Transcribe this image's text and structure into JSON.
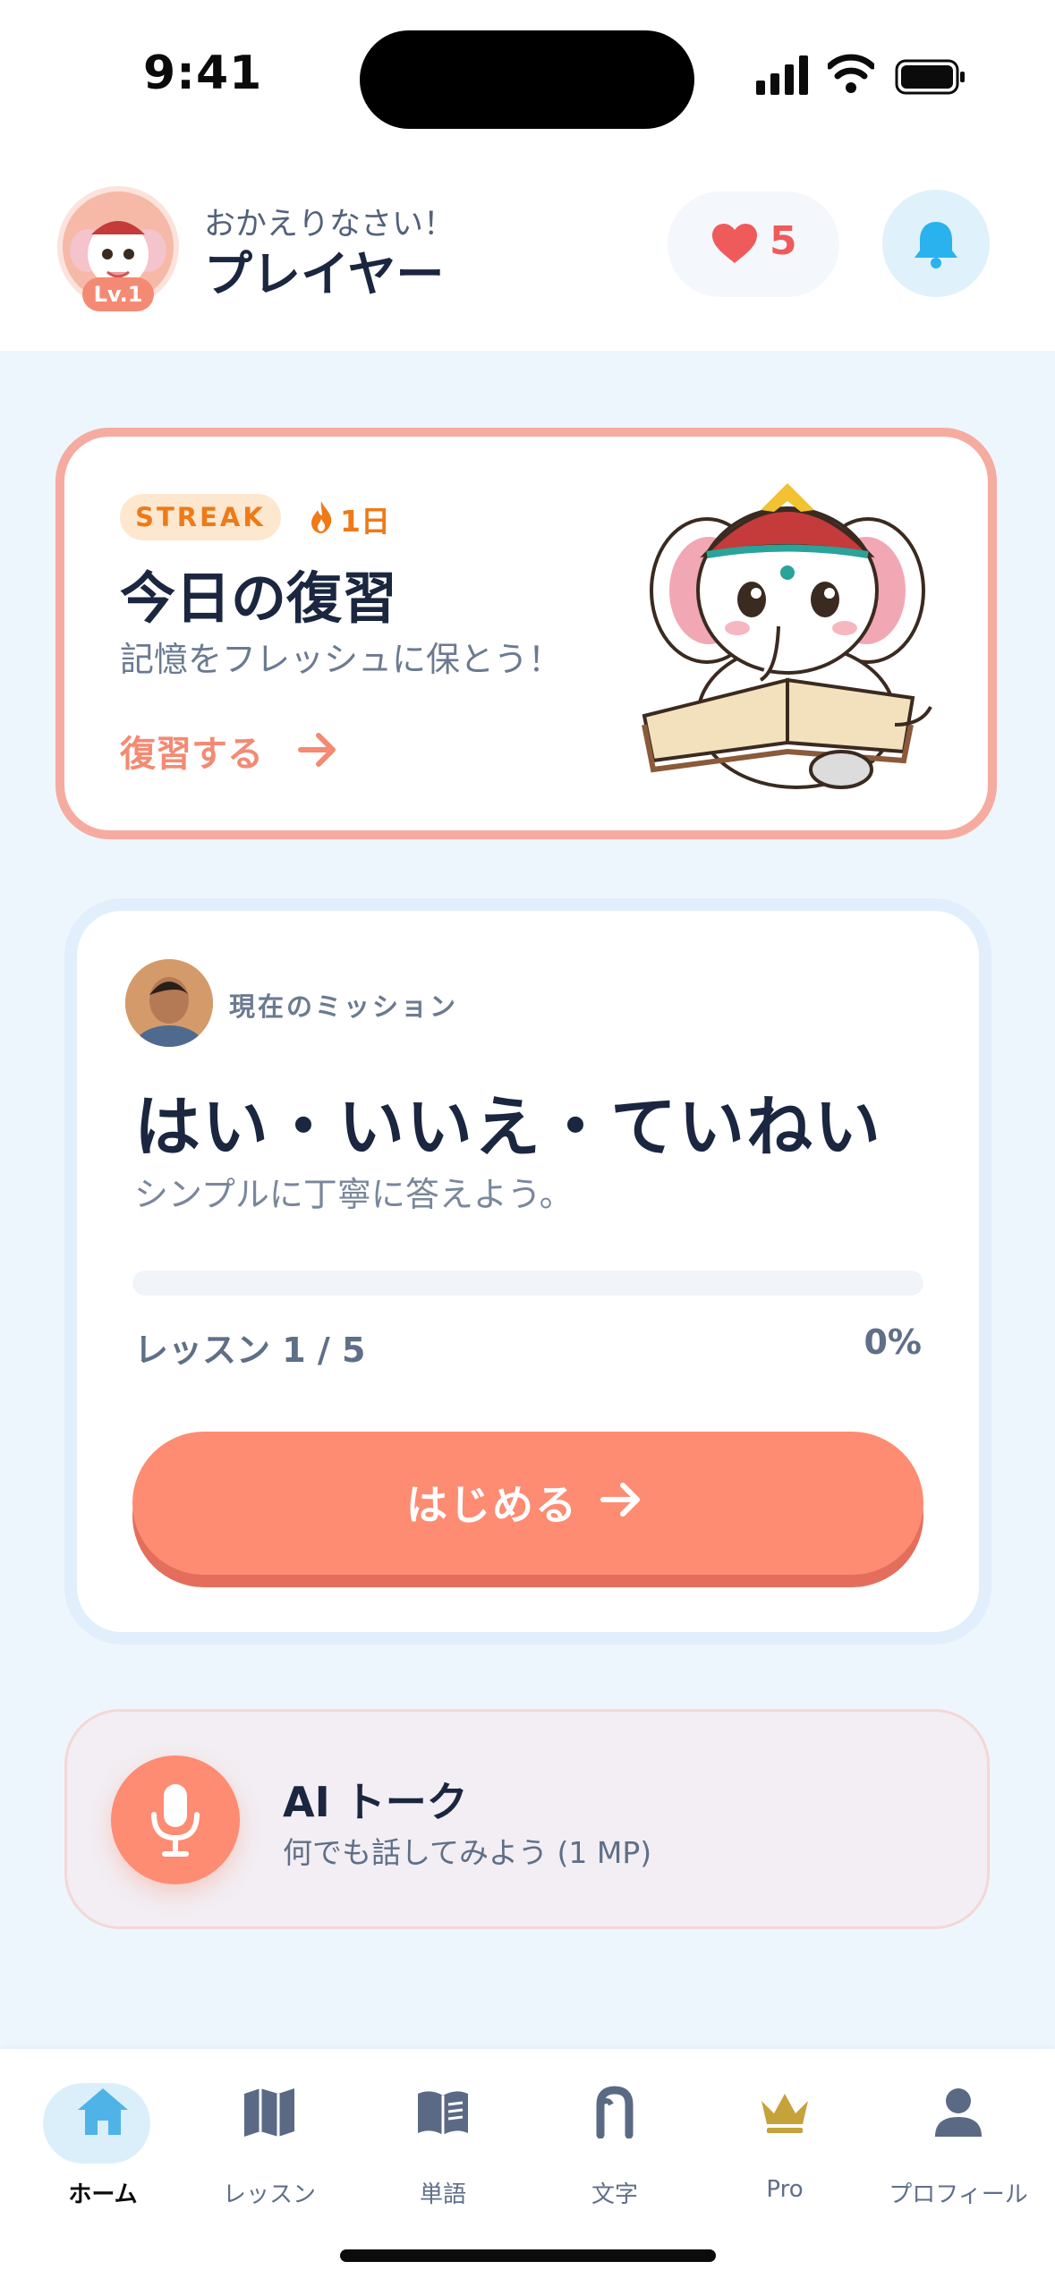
{
  "status_bar": {
    "time": "9:41"
  },
  "header": {
    "greeting": "おかえりなさい！",
    "username": "プレイヤー",
    "level": "Lv.1",
    "hearts": "5"
  },
  "review_card": {
    "badge": "STREAK",
    "streak_days": "1日",
    "title": "今日の復習",
    "subtitle": "記憶をフレッシュに保とう！",
    "link": "復習する"
  },
  "mission_card": {
    "label": "現在のミッション",
    "title": "はい・いいえ・ていねい",
    "subtitle": "シンプルに丁寧に答えよう。",
    "lesson_progress": "レッスン 1 / 5",
    "percent": "0%",
    "progress_fraction": 0,
    "start_label": "はじめる"
  },
  "ai_talk": {
    "title": "AI トーク",
    "subtitle": "何でも話してみよう (1 MP)"
  },
  "tabs": [
    {
      "label": "ホーム",
      "icon": "home-icon",
      "active": true
    },
    {
      "label": "レッスン",
      "icon": "map-icon",
      "active": false
    },
    {
      "label": "単語",
      "icon": "book-icon",
      "active": false
    },
    {
      "label": "文字",
      "icon": "thai-letter-icon",
      "active": false
    },
    {
      "label": "Pro",
      "icon": "crown-icon",
      "active": false
    },
    {
      "label": "プロフィール",
      "icon": "person-icon",
      "active": false
    }
  ],
  "colors": {
    "accent": "#fd8c73",
    "streak": "#ee7a18",
    "heart": "#ef5a5a",
    "bell": "#29b2ee",
    "background": "#eef6fd"
  }
}
